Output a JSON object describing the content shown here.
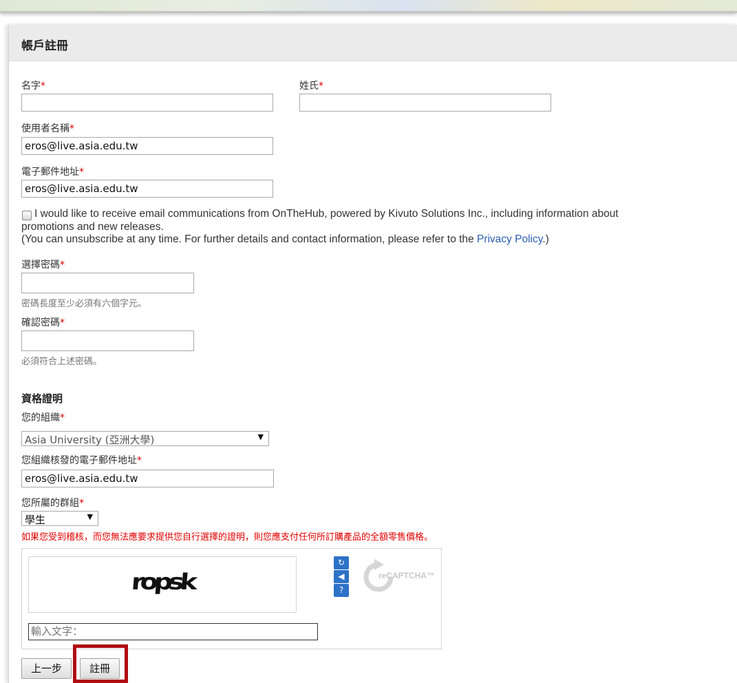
{
  "header": {
    "title": "帳戶註冊"
  },
  "form": {
    "first_name": {
      "label": "名字",
      "value": ""
    },
    "last_name": {
      "label": "姓氏",
      "value": ""
    },
    "username": {
      "label": "使用者名稱",
      "value": "eros@live.asia.edu.tw"
    },
    "email": {
      "label": "電子郵件地址",
      "value": "eros@live.asia.edu.tw"
    },
    "required_mark": "*",
    "consent": {
      "line1": "I would like to receive email communications from OnTheHub, powered by Kivuto Solutions Inc., including information about",
      "line2": "promotions and new releases.",
      "line3_prefix": "(You can unsubscribe at any time. For further details and contact information, please refer to the ",
      "link_text": "Privacy Policy",
      "line3_suffix": ".)"
    },
    "password": {
      "label": "選擇密碼",
      "hint": "密碼長度至少必須有六個字元。"
    },
    "confirm_password": {
      "label": "確認密碼",
      "hint": "必須符合上述密碼。"
    }
  },
  "credentials": {
    "title": "資格證明",
    "organization": {
      "label": "您的組織",
      "selected": "Asia University (亞洲大學)"
    },
    "org_email": {
      "label": "您組織核發的電子郵件地址",
      "value": "eros@live.asia.edu.tw"
    },
    "group": {
      "label": "您所屬的群組",
      "selected": "學生"
    },
    "warning": "如果您受到稽核，而您無法應要求提供您自行選擇的證明，則您應支付任何所訂購產品的全額零售價格。"
  },
  "captcha": {
    "challenge_text": "ropsk",
    "input_placeholder": "輸入文字：",
    "logo_text": "reCAPTCHA™",
    "refresh_icon": "refresh-icon",
    "audio_icon": "audio-icon",
    "help_icon": "help-icon"
  },
  "buttons": {
    "back": "上一步",
    "register": "註冊"
  },
  "colors": {
    "required": "#dd0000",
    "warning": "#e00000",
    "link": "#2a5db0",
    "highlight": "#b00b12",
    "captcha_button": "#2d72c6"
  }
}
